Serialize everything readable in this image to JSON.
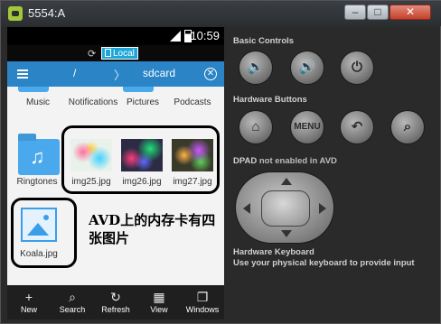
{
  "window": {
    "title": "5554:A",
    "min_glyph": "–",
    "max_glyph": "□",
    "close_glyph": "✕"
  },
  "device": {
    "status_time": "10:59",
    "signal_glyph": "3G",
    "sync_glyph": "⟳",
    "local_tab": "Local",
    "path_root": "/",
    "path_sep": "〉",
    "path_current": "sdcard",
    "close_glyph": "✕",
    "folders_top": [
      {
        "label": "Music"
      },
      {
        "label": "Notifications"
      },
      {
        "label": "Pictures"
      },
      {
        "label": "Podcasts"
      }
    ],
    "files": [
      {
        "label": "Ringtones"
      },
      {
        "label": "img25.jpg"
      },
      {
        "label": "img26.jpg"
      },
      {
        "label": "img27.jpg"
      },
      {
        "label": "Koala.jpg"
      }
    ],
    "music_glyph": "♫",
    "annotation": "AVD上的内存卡有四张图片",
    "bottom_bar": [
      {
        "label": "New",
        "glyph": "+",
        "icon": "plus-icon"
      },
      {
        "label": "Search",
        "glyph": "⌕",
        "icon": "search-icon"
      },
      {
        "label": "Refresh",
        "glyph": "↻",
        "icon": "refresh-icon"
      },
      {
        "label": "View",
        "glyph": "▦",
        "icon": "grid-icon"
      },
      {
        "label": "Windows",
        "glyph": "❐",
        "icon": "windows-icon"
      }
    ]
  },
  "controls": {
    "basic_title": "Basic Controls",
    "basic_buttons": [
      {
        "glyph": "🔈",
        "icon": "volume-down-icon"
      },
      {
        "glyph": "🔊",
        "icon": "volume-up-icon"
      },
      {
        "glyph": "⏻",
        "icon": "power-icon"
      }
    ],
    "hardware_title": "Hardware Buttons",
    "hardware_buttons": [
      {
        "glyph": "⌂",
        "icon": "home-icon"
      },
      {
        "glyph": "MENU",
        "icon": "menu-icon"
      },
      {
        "glyph": "↶",
        "icon": "back-icon"
      },
      {
        "glyph": "⌕",
        "icon": "search-icon"
      }
    ],
    "dpad_title": "DPAD",
    "dpad_note": "not enabled in AVD",
    "keyboard_title": "Hardware Keyboard",
    "keyboard_note": "Use your physical keyboard to provide input"
  }
}
